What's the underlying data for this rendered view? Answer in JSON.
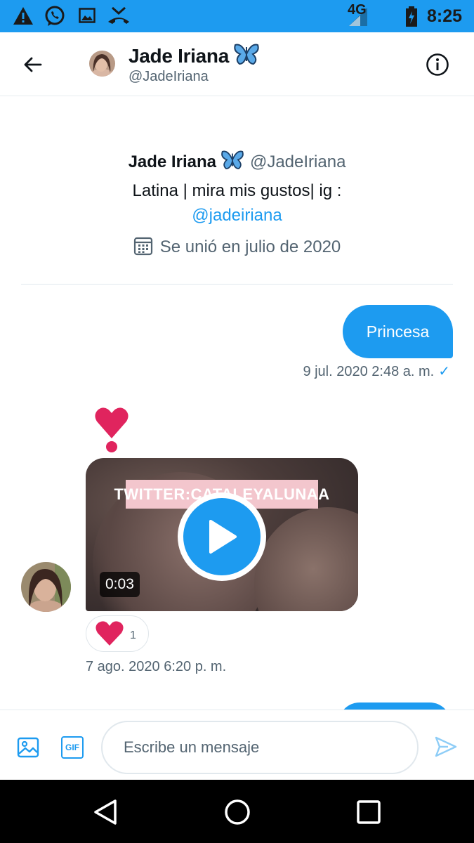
{
  "status_bar": {
    "network": "4G",
    "time": "8:25",
    "icons": [
      "warning-icon",
      "whatsapp-icon",
      "image-icon",
      "missed-call-icon",
      "signal-icon",
      "battery-charging-icon"
    ]
  },
  "header": {
    "name": "Jade Iriana",
    "handle": "@JadeIriana",
    "icons": [
      "back-arrow-icon",
      "butterfly-emoji-icon",
      "info-icon"
    ]
  },
  "profile": {
    "name": "Jade Iriana",
    "handle": "@JadeIriana",
    "bio": "Latina | mira mis gustos| ig :",
    "bio_link": "@jadeiriana",
    "joined": "Se unió en julio de 2020"
  },
  "messages": [
    {
      "direction": "out",
      "text": "Princesa",
      "timestamp": "9 jul. 2020 2:48 a. m.",
      "status": "✓"
    },
    {
      "direction": "in",
      "type": "video",
      "video_banner": "TWITTER:CATALEYALUNAA",
      "duration": "0:03",
      "reaction_count": "1",
      "timestamp": "7 ago. 2020 6:20 p. m."
    }
  ],
  "composer": {
    "placeholder": "Escribe un mensaje",
    "gif_label": "GIF",
    "icons": [
      "image-icon",
      "gif-icon",
      "send-icon"
    ]
  },
  "nav_bar": {
    "icons": [
      "back-triangle-icon",
      "home-circle-icon",
      "recents-square-icon"
    ]
  },
  "colors": {
    "accent": "#1d9bf0",
    "heart": "#e0245e",
    "text_secondary": "#536471",
    "status_bar": "#1d9bf0"
  }
}
